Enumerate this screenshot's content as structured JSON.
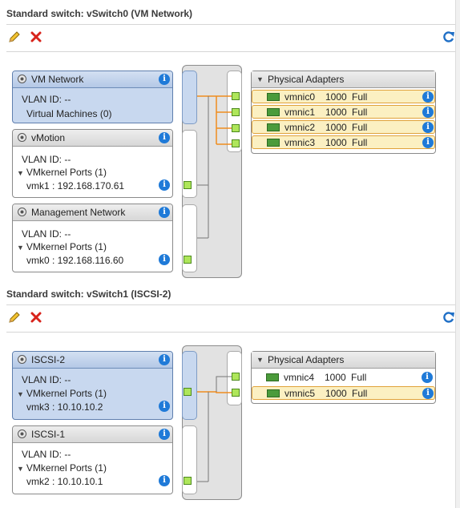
{
  "switches": [
    {
      "title": "Standard switch: vSwitch0 (VM Network)",
      "port_groups": [
        {
          "name": "VM Network",
          "vlan": "VLAN ID: --",
          "ports_label": "Virtual Machines (0)",
          "entry": ""
        },
        {
          "name": "vMotion",
          "vlan": "VLAN ID: --",
          "ports_label": "VMkernel Ports (1)",
          "entry": "vmk1 : 192.168.170.61"
        },
        {
          "name": "Management Network",
          "vlan": "VLAN ID: --",
          "ports_label": "VMkernel Ports (1)",
          "entry": "vmk0 : 192.168.116.60"
        }
      ],
      "physical_adapters": {
        "title": "Physical Adapters",
        "items": [
          {
            "name": "vmnic0",
            "speed": "1000",
            "duplex": "Full"
          },
          {
            "name": "vmnic1",
            "speed": "1000",
            "duplex": "Full"
          },
          {
            "name": "vmnic2",
            "speed": "1000",
            "duplex": "Full"
          },
          {
            "name": "vmnic3",
            "speed": "1000",
            "duplex": "Full"
          }
        ]
      }
    },
    {
      "title": "Standard switch: vSwitch1 (ISCSI-2)",
      "port_groups": [
        {
          "name": "ISCSI-2",
          "vlan": "VLAN ID: --",
          "ports_label": "VMkernel Ports (1)",
          "entry": "vmk3 : 10.10.10.2"
        },
        {
          "name": "ISCSI-1",
          "vlan": "VLAN ID: --",
          "ports_label": "VMkernel Ports (1)",
          "entry": "vmk2 : 10.10.10.1"
        }
      ],
      "physical_adapters": {
        "title": "Physical Adapters",
        "items": [
          {
            "name": "vmnic4",
            "speed": "1000",
            "duplex": "Full"
          },
          {
            "name": "vmnic5",
            "speed": "1000",
            "duplex": "Full"
          }
        ]
      }
    }
  ],
  "icons": {
    "edit": "pencil-icon",
    "remove": "red-x-icon",
    "refresh": "refresh-icon",
    "info": "info-icon",
    "portgroup": "portgroup-icon",
    "nic": "nic-icon"
  },
  "info_glyph": "i",
  "colors": {
    "selected_fill": "#c8d8ef",
    "nic_highlight": "#fbf0c2",
    "link_orange": "#f08c1e",
    "port_green": "#aee65a",
    "info_blue": "#1f7ad8"
  }
}
